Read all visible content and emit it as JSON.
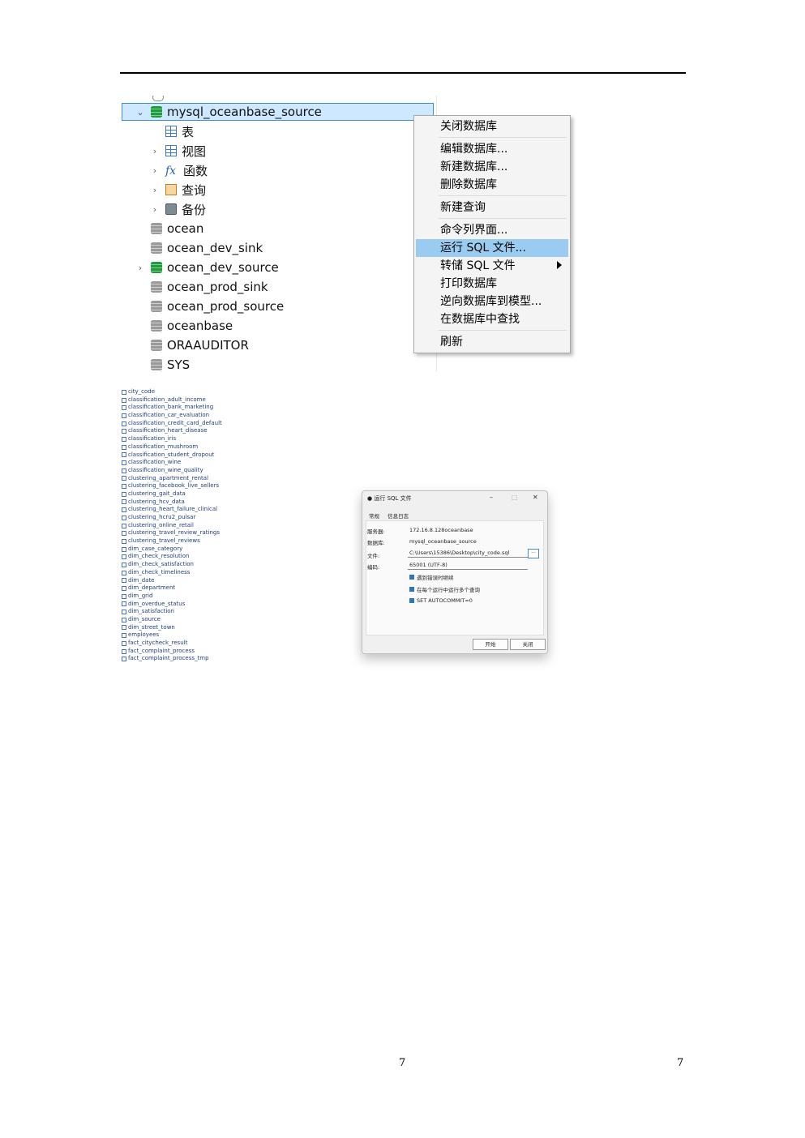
{
  "tree": {
    "selected_db": "mysql_oceanbase_source",
    "children": [
      {
        "label": "表",
        "icon": "table-icon",
        "expandable": false
      },
      {
        "label": "视图",
        "icon": "view-icon",
        "expandable": true
      },
      {
        "label": "函数",
        "icon": "function-icon",
        "expandable": true
      },
      {
        "label": "查询",
        "icon": "query-icon",
        "expandable": true
      },
      {
        "label": "备份",
        "icon": "backup-icon",
        "expandable": true
      }
    ],
    "databases": [
      {
        "label": "ocean",
        "color": "gray",
        "expandable": false
      },
      {
        "label": "ocean_dev_sink",
        "color": "gray",
        "expandable": false
      },
      {
        "label": "ocean_dev_source",
        "color": "green",
        "expandable": true
      },
      {
        "label": "ocean_prod_sink",
        "color": "gray",
        "expandable": false
      },
      {
        "label": "ocean_prod_source",
        "color": "gray",
        "expandable": false
      },
      {
        "label": "oceanbase",
        "color": "gray",
        "expandable": false
      },
      {
        "label": "ORAAUDITOR",
        "color": "gray",
        "expandable": false
      },
      {
        "label": "SYS",
        "color": "gray",
        "expandable": false
      }
    ]
  },
  "context_menu": {
    "items": [
      {
        "label": "关闭数据库",
        "sep_after": true
      },
      {
        "label": "编辑数据库..."
      },
      {
        "label": "新建数据库..."
      },
      {
        "label": "删除数据库",
        "sep_after": true
      },
      {
        "label": "新建查询",
        "sep_after": true
      },
      {
        "label": "命令列界面..."
      },
      {
        "label": "运行 SQL 文件...",
        "highlighted": true
      },
      {
        "label": "转储 SQL 文件",
        "submenu": true
      },
      {
        "label": "打印数据库"
      },
      {
        "label": "逆向数据库到模型..."
      },
      {
        "label": "在数据库中查找",
        "sep_after": true
      },
      {
        "label": "刷新"
      }
    ]
  },
  "table_list": [
    "city_code",
    "classification_adult_income",
    "classification_bank_marketing",
    "classification_car_evaluation",
    "classification_credit_card_default",
    "classification_heart_disease",
    "classification_iris",
    "classification_mushroom",
    "classification_student_dropout",
    "classification_wine",
    "classification_wine_quality",
    "clustering_apartment_rental",
    "clustering_facebook_live_sellers",
    "clustering_gait_data",
    "clustering_hcv_data",
    "clustering_heart_failure_clinical",
    "clustering_hcru2_pulsar",
    "clustering_online_retail",
    "clustering_travel_review_ratings",
    "clustering_travel_reviews",
    "dim_case_category",
    "dim_check_resolution",
    "dim_check_satisfaction",
    "dim_check_timeliness",
    "dim_date",
    "dim_department",
    "dim_grid",
    "dim_overdue_status",
    "dim_satisfaction",
    "dim_source",
    "dim_street_town",
    "employees",
    "fact_citycheck_result",
    "fact_complaint_process",
    "fact_complaint_process_tmp"
  ],
  "dialog": {
    "title": "运行 SQL 文件",
    "tabs": [
      "常规",
      "信息日志"
    ],
    "fields": [
      {
        "label": "服务器:",
        "value": "172.16.8.128oceanbase"
      },
      {
        "label": "数据库:",
        "value": "mysql_oceanbase_source"
      },
      {
        "label": "文件:",
        "value": "C:\\Users\\15386\\Desktop\\city_code.sql"
      },
      {
        "label": "编码:",
        "value": "65001 (UTF-8)"
      }
    ],
    "checkboxes": [
      "遇到错误时继续",
      "在每个运行中运行多个查询",
      "SET AUTOCOMMIT=0"
    ],
    "browse_label": "...",
    "start_button": "开始",
    "close_button": "关闭"
  },
  "page_numbers": [
    "7",
    "7"
  ]
}
